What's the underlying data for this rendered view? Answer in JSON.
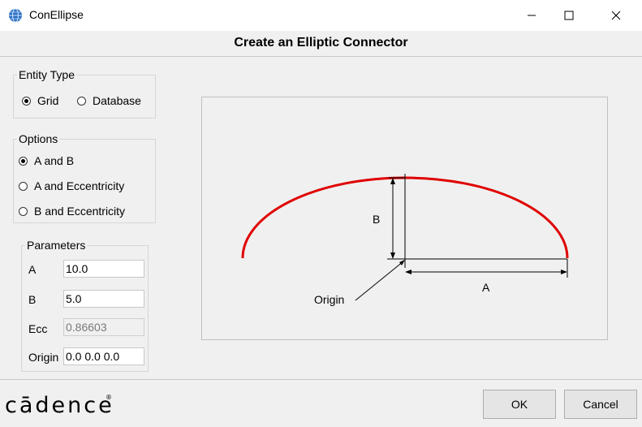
{
  "window": {
    "title": "ConEllipse",
    "minimize_glyph": "—",
    "maximize_glyph": "☐",
    "close_glyph": "✕",
    "icon": "globe-icon"
  },
  "header": {
    "title": "Create an Elliptic Connector"
  },
  "entity_type": {
    "legend": "Entity Type",
    "options": [
      {
        "label": "Grid",
        "selected": true
      },
      {
        "label": "Database",
        "selected": false
      }
    ]
  },
  "options": {
    "legend": "Options",
    "items": [
      {
        "label": "A and B",
        "selected": true
      },
      {
        "label": "A and Eccentricity",
        "selected": false
      },
      {
        "label": "B and Eccentricity",
        "selected": false
      }
    ]
  },
  "parameters": {
    "legend": "Parameters",
    "a": {
      "label": "A",
      "value": "10.0"
    },
    "b": {
      "label": "B",
      "value": "5.0"
    },
    "ecc": {
      "label": "Ecc",
      "value": "0.86603",
      "disabled": true
    },
    "origin": {
      "label": "Origin",
      "value": "0.0 0.0 0.0"
    }
  },
  "diagram": {
    "label_a": "A",
    "label_b": "B",
    "label_origin": "Origin",
    "curve_color": "#e00000"
  },
  "footer": {
    "logo_text": "cādence",
    "logo_mark": "®",
    "ok_label": "OK",
    "cancel_label": "Cancel"
  }
}
